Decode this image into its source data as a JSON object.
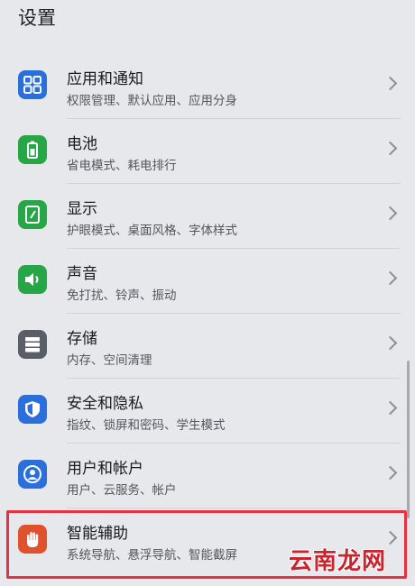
{
  "header": {
    "title": "设置"
  },
  "items": [
    {
      "title": "应用和通知",
      "subtitle": "权限管理、默认应用、应用分身",
      "icon": "apps-grid-icon",
      "color": "#2a6fdc"
    },
    {
      "title": "电池",
      "subtitle": "省电模式、耗电排行",
      "icon": "battery-icon",
      "color": "#27a648"
    },
    {
      "title": "显示",
      "subtitle": "护眼模式、桌面风格、字体样式",
      "icon": "display-icon",
      "color": "#27a648"
    },
    {
      "title": "声音",
      "subtitle": "免打扰、铃声、振动",
      "icon": "speaker-icon",
      "color": "#27a648"
    },
    {
      "title": "存储",
      "subtitle": "内存、空间清理",
      "icon": "storage-icon",
      "color": "#5a5e66"
    },
    {
      "title": "安全和隐私",
      "subtitle": "指纹、锁屏和密码、学生模式",
      "icon": "shield-icon",
      "color": "#2a6fdc"
    },
    {
      "title": "用户和帐户",
      "subtitle": "用户、云服务、帐户",
      "icon": "user-icon",
      "color": "#2a6fdc"
    },
    {
      "title": "智能辅助",
      "subtitle": "系统导航、悬浮导航、智能截屏",
      "icon": "hand-icon",
      "color": "#e0512e"
    }
  ],
  "watermark": "云南龙网",
  "highlight_color": "#e8303f"
}
